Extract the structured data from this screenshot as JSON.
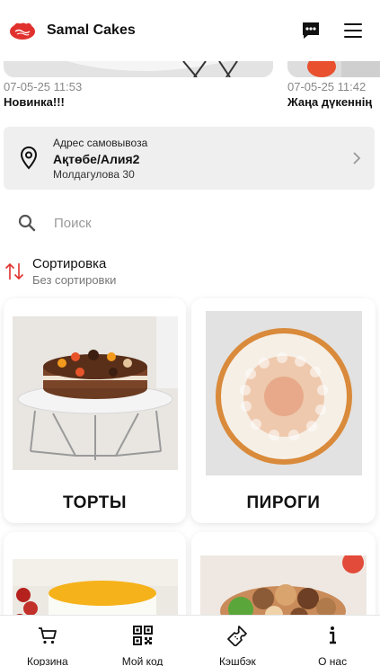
{
  "app": {
    "title": "Samal Cakes",
    "logo_icon": "samal-cakes-logo-icon",
    "brand_color": "#e0312e"
  },
  "header": {
    "chat_icon": "chat-bubble-icon",
    "menu_icon": "hamburger-menu-icon"
  },
  "stories": [
    {
      "date": "07-05-25 11:53",
      "title": "Новинка!!!"
    },
    {
      "date": "07-05-25 11:42",
      "title": "Жаңа дүкеннің"
    }
  ],
  "pickup": {
    "label": "Адрес самовывоза",
    "city": "Ақтөбе/Алия2",
    "street": "Молдагулова 30",
    "icon": "location-pin-icon",
    "chevron_icon": "chevron-right-icon"
  },
  "search": {
    "placeholder": "Поиск",
    "value": "",
    "icon": "search-icon"
  },
  "sort": {
    "title": "Сортировка",
    "value": "Без сортировки",
    "icon": "sort-arrows-icon",
    "icon_color": "#e0312e"
  },
  "categories": [
    {
      "label": "ТОРТЫ"
    },
    {
      "label": "ПИРОГИ"
    },
    {
      "label": ""
    },
    {
      "label": ""
    }
  ],
  "bottom_nav": [
    {
      "label": "Корзина",
      "icon": "cart-icon"
    },
    {
      "label": "Мой код",
      "icon": "qr-code-icon"
    },
    {
      "label": "Кэшбэк",
      "icon": "ticket-icon"
    },
    {
      "label": "О нас",
      "icon": "info-icon"
    }
  ]
}
